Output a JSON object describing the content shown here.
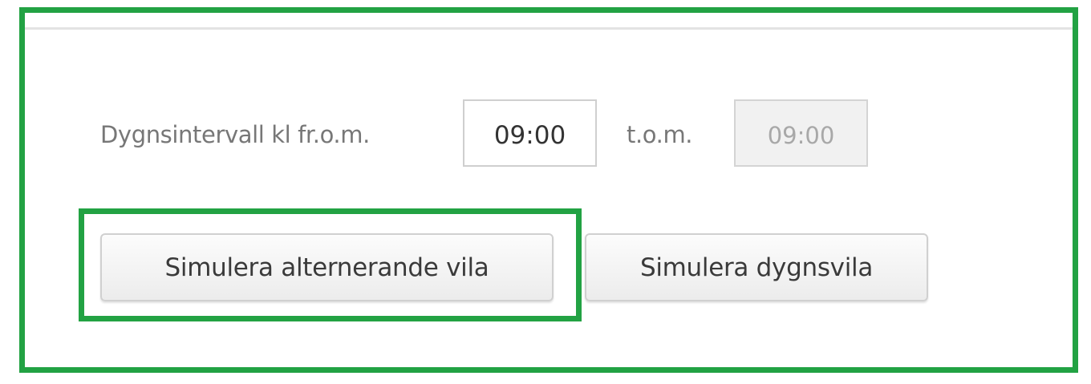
{
  "interval": {
    "label_from": "Dygnsintervall kl fr.o.m.",
    "from_value": "09:00",
    "label_to": "t.o.m.",
    "to_value": "09:00"
  },
  "actions": {
    "simulate_alternating_rest_label": "Simulera alternerande vila",
    "simulate_daily_rest_label": "Simulera dygnsvila"
  },
  "colors": {
    "highlight_green": "#22a243",
    "button_border": "#d0d0d0",
    "label_text": "#777777",
    "disabled_background": "#f1f1f1"
  }
}
